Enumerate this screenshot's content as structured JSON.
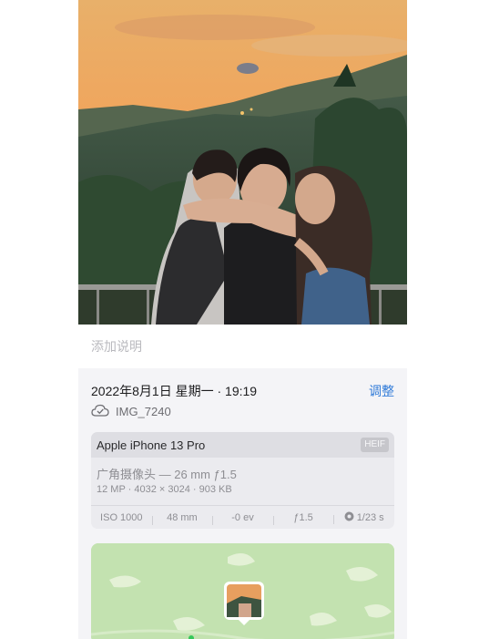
{
  "caption": {
    "placeholder": "添加说明"
  },
  "info": {
    "date_time": "2022年8月1日 星期一 · 19:19",
    "adjust_label": "调整",
    "file_name": "IMG_7240",
    "icons": {
      "cloud": "cloud-check-icon",
      "aperture": "aperture-icon"
    }
  },
  "camera": {
    "model": "Apple iPhone 13 Pro",
    "format": "HEIF",
    "lens": "广角摄像头 — 26 mm ƒ1.5",
    "specs": "12 MP · 4032 × 3024 · 903 KB"
  },
  "exif": {
    "iso": "ISO 1000",
    "focal": "48 mm",
    "ev": "-0 ev",
    "aperture": "ƒ1.5",
    "shutter": "1/23 s"
  },
  "colors": {
    "accent": "#2f7ad8",
    "card_bg": "#f4f4f7",
    "map_green": "#bfe0ad"
  }
}
